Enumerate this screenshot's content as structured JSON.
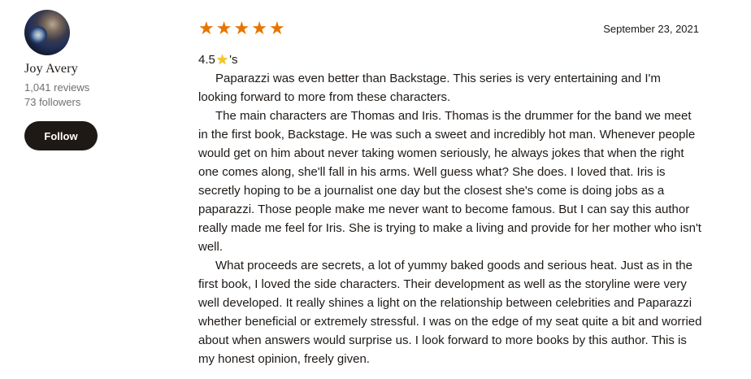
{
  "reviewer": {
    "name": "Joy Avery",
    "reviews": "1,041 reviews",
    "followers": "73 followers",
    "follow_label": "Follow"
  },
  "review": {
    "star_rating": 5,
    "date": "September 23, 2021",
    "rating_prefix": "4.5",
    "rating_suffix": "'s",
    "rating_icon": "star-emoji-icon",
    "paragraphs": [
      "Paparazzi was even better than Backstage. This series is very entertaining and I'm looking forward to more from these characters.",
      "The main characters are Thomas and Iris. Thomas is the drummer for the band we meet in the first book, Backstage. He was such a sweet and incredibly hot man. Whenever people would get on him about never taking women seriously, he always jokes that when the right one comes along, she'll fall in his arms. Well guess what? She does. I loved that. Iris is secretly hoping to be a journalist one day but the closest she's come is doing jobs as a paparazzi. Those people make me never want to become famous. But I can say this author really made me feel for Iris. She is trying to make a living and provide for her mother who isn't well.",
      "What proceeds are secrets, a lot of yummy baked goods and serious heat. Just as in the first book, I loved the side characters. Their development as well as the storyline were very well developed. It really shines a light on the relationship between celebrities and Paparazzi whether beneficial or extremely stressful. I was on the edge of my seat quite a bit and worried about when answers would surprise us. I look forward to more books by this author. This is my honest opinion, freely given."
    ]
  },
  "colors": {
    "star": "#e87400",
    "button_bg": "#1e1915",
    "text": "#1e1915",
    "meta": "#707070"
  }
}
